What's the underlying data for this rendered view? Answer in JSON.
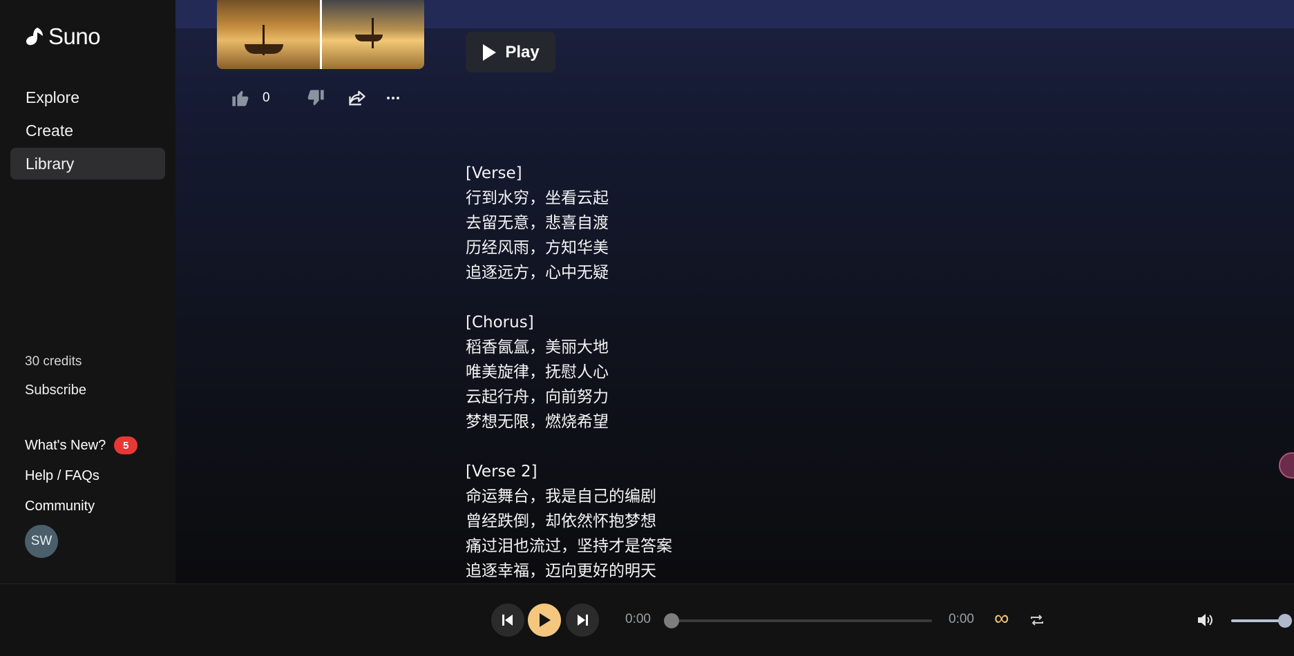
{
  "brand": {
    "name": "Suno"
  },
  "nav": {
    "items": [
      {
        "label": "Explore"
      },
      {
        "label": "Create"
      },
      {
        "label": "Library"
      }
    ]
  },
  "account": {
    "credits": "30 credits",
    "subscribe": "Subscribe",
    "whats_new": "What's New?",
    "whats_new_badge": "5",
    "help": "Help / FAQs",
    "community": "Community",
    "avatar_initials": "SW"
  },
  "song": {
    "like_count": "0",
    "play_label": "Play",
    "lyrics": [
      "[Verse]",
      "行到水穷，坐看云起",
      "去留无意，悲喜自渡",
      "历经风雨，方知华美",
      "追逐远方，心中无疑",
      "",
      "[Chorus]",
      "稻香氤氲，美丽大地",
      "唯美旋律，抚慰人心",
      "云起行舟，向前努力",
      "梦想无限，燃烧希望",
      "",
      "[Verse 2]",
      "命运舞台，我是自己的编剧",
      "曾经跌倒，却依然怀抱梦想",
      "痛过泪也流过，坚持才是答案",
      "追逐幸福，迈向更好的明天"
    ]
  },
  "player": {
    "time_elapsed": "0:00",
    "time_total": "0:00",
    "progress": 0,
    "volume": 0.9
  },
  "colors": {
    "accent": "#f5c77e",
    "badge": "#e53935",
    "sidebar_bg": "#141414",
    "active_nav_bg": "#2e2e30"
  }
}
